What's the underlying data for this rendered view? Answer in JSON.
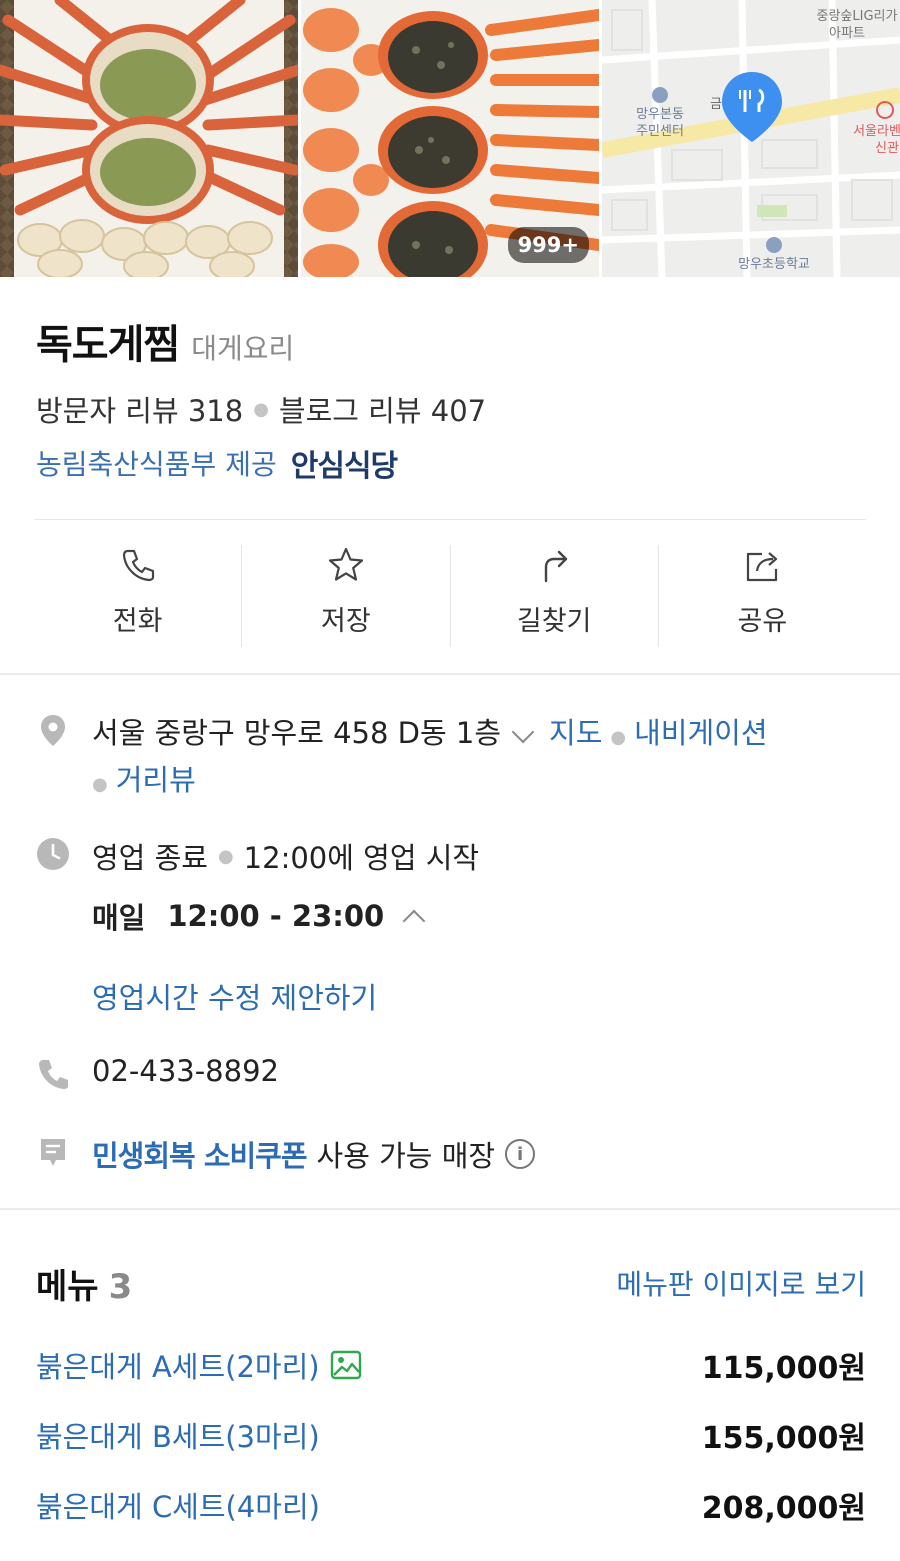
{
  "photos": {
    "count_badge": "999+",
    "map_labels": {
      "apartment": "중랑숲LIG리가\n아파트",
      "community_center": "망우본동\n주민센터",
      "partial": "금",
      "school": "망우초등학교",
      "station": "서울라벤\n신관"
    }
  },
  "place": {
    "name": "독도게찜",
    "category": "대게요리",
    "visitor_reviews": "방문자 리뷰 318",
    "blog_reviews": "블로그 리뷰 407",
    "cert_provider": "농림축산식품부 제공",
    "cert_name": "안심식당"
  },
  "actions": [
    {
      "label": "전화",
      "icon": "phone-icon"
    },
    {
      "label": "저장",
      "icon": "star-icon"
    },
    {
      "label": "길찾기",
      "icon": "directions-icon"
    },
    {
      "label": "공유",
      "icon": "share-icon"
    }
  ],
  "info": {
    "address": "서울 중랑구 망우로 458 D동 1층",
    "map_link": "지도",
    "navi_link": "내비게이션",
    "street_view_link": "거리뷰",
    "hours_status": "영업 종료",
    "hours_next": "12:00에 영업 시작",
    "hours_day": "매일",
    "hours_time": "12:00 - 23:00",
    "hours_edit": "영업시간 수정 제안하기",
    "phone": "02-433-8892",
    "coupon_name": "민생회복 소비쿠폰",
    "coupon_text": "사용 가능 매장"
  },
  "menu": {
    "title": "메뉴",
    "count": "3",
    "view_link": "메뉴판 이미지로 보기",
    "items": [
      {
        "name": "붉은대게 A세트(2마리)",
        "price": "115,000원",
        "has_image": true
      },
      {
        "name": "붉은대게 B세트(3마리)",
        "price": "155,000원",
        "has_image": false
      },
      {
        "name": "붉은대게 C세트(4마리)",
        "price": "208,000원",
        "has_image": false
      }
    ]
  },
  "colors": {
    "link": "#2b6cb5",
    "pin": "#3d8ff0",
    "coupon_icon_green": "#2fa84f"
  }
}
